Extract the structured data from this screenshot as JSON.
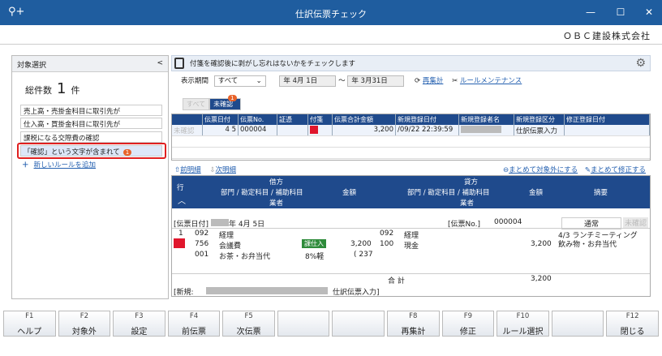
{
  "window": {
    "title": "仕訳伝票チェック",
    "company": "ＯＢＣ建設株式会社"
  },
  "left_panel": {
    "header": "対象選択",
    "total_label": "総件数",
    "total_count": "1",
    "total_unit": "件",
    "rules": [
      "売上高・売掛金科目に取引先が",
      "仕入高・買掛金科目に取引先が",
      "課税になる交際費の確認",
      "「確認」という文字が含まれて"
    ],
    "selected_badge": "1",
    "add_rule": "新しいルールを追加"
  },
  "info_text": "付箋を確認後に剥がし忘れはないかをチェックします",
  "filters": {
    "period_label": "表示期間",
    "period_value": "すべて",
    "date_from": "年  4月  1日",
    "tilde": "～",
    "date_to": "年  3月31日",
    "recalc": "再集計",
    "rule_maint": "ルールメンテナンス"
  },
  "tabs": {
    "all": "すべて",
    "unconfirmed": "未確認",
    "unconfirmed_badge": "1"
  },
  "top_grid": {
    "headers": [
      "伝票日付",
      "伝票No.",
      "証憑",
      "付箋",
      "伝票合計金額",
      "新規登録日付",
      "新規登録者名",
      "新規登録区分",
      "修正登録日付"
    ],
    "row": {
      "status": "未確認",
      "date": "4  5",
      "no": "000004",
      "amount": "3,200",
      "reg_date": "/09/22 22:39:59",
      "reg_kind": "仕訳伝票入力"
    }
  },
  "nav": {
    "prev": "前明細",
    "next": "次明細",
    "exclude_all": "まとめて対象外にする",
    "fix_all": "まとめて修正する"
  },
  "detail": {
    "row_label": "行",
    "debit": "借方",
    "credit": "貸方",
    "sub_header": "部門 / 勘定科目 / 補助科目",
    "amount": "金額",
    "vendor": "業者",
    "memo": "摘要",
    "date_label": "[伝票日付]",
    "date_value": "年  4月  5日",
    "no_label": "[伝票No.]",
    "no_value": "000004",
    "normal": "通常",
    "unconfirmed": "未確認",
    "line_no": "1",
    "d_dept_code": "092",
    "d_dept": "経理",
    "d_acct_code": "756",
    "d_acct": "会議費",
    "d_tax_tag": "課仕入",
    "d_amount": "3,200",
    "d_sub_code": "001",
    "d_sub": "お茶・お弁当代",
    "d_tax": "8%軽",
    "d_tax_amt": "( 237",
    "c_dept_code": "092",
    "c_dept": "経理",
    "c_acct_code": "100",
    "c_acct": "現金",
    "c_amount": "3,200",
    "memo_1": "4/3 ランチミーティング",
    "memo_2": "飲み物・お弁当代",
    "total_label": "合 計",
    "total_amount": "3,200",
    "new_label": "[新規:",
    "new_kind": "仕訳伝票入力]"
  },
  "fkeys": [
    {
      "n": "F1",
      "l": "ヘルプ"
    },
    {
      "n": "F2",
      "l": "対象外"
    },
    {
      "n": "F3",
      "l": "設定"
    },
    {
      "n": "F4",
      "l": "前伝票"
    },
    {
      "n": "F5",
      "l": "次伝票"
    },
    {
      "n": "",
      "l": ""
    },
    {
      "n": "",
      "l": ""
    },
    {
      "n": "F8",
      "l": "再集計"
    },
    {
      "n": "F9",
      "l": "修正"
    },
    {
      "n": "F10",
      "l": "ルール選択"
    },
    {
      "n": "",
      "l": ""
    },
    {
      "n": "F12",
      "l": "閉じる"
    }
  ]
}
